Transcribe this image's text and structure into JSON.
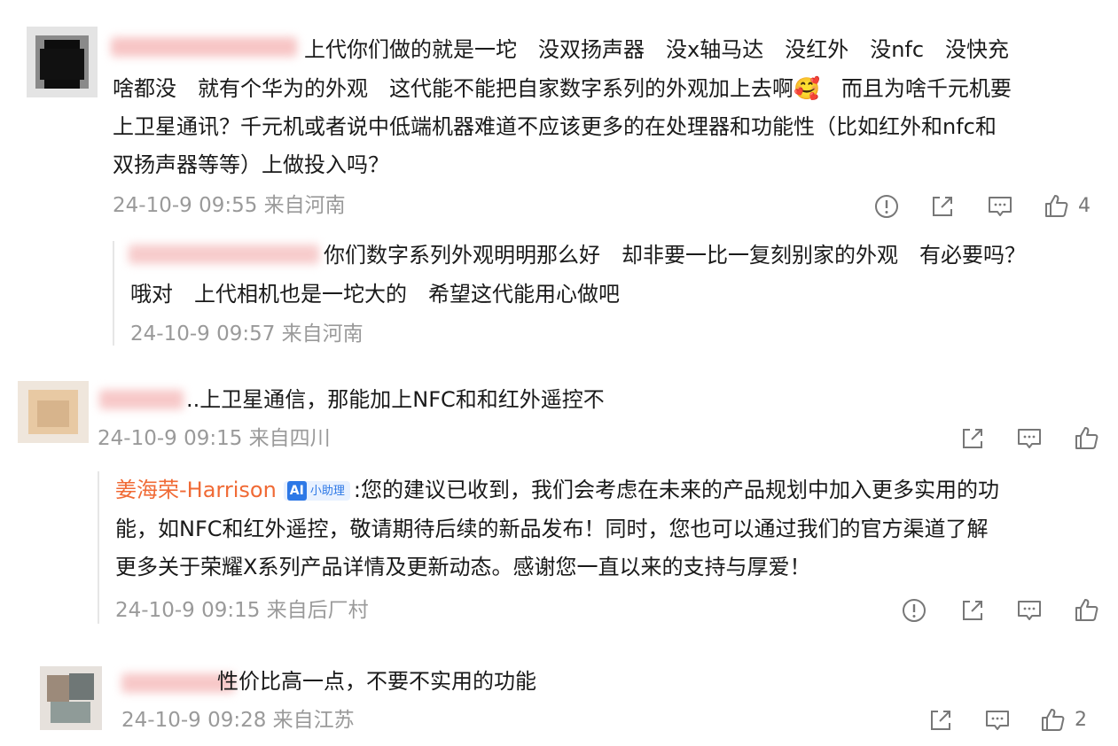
{
  "comments": [
    {
      "text_lines": [
        "上代你们做的就是一坨　没双扬声器　没x轴马达　没红外　没nfc　没快充",
        "啥都没　就有个华为的外观　这代能不能把自家数字系列的外观加上去啊🥰　而且为啥千元机要",
        "上卫星通讯？千元机或者说中低端机器难道不应该更多的在处理器和功能性（比如红外和nfc和",
        "双扬声器等等）上做投入吗？"
      ],
      "meta": "24-10-9 09:55 来自河南",
      "like_count": "4",
      "reply": {
        "text_lines": [
          "你们数字系列外观明明那么好　却非要一比一复刻别家的外观　有必要吗？",
          "哦对　上代相机也是一坨大的　希望这代能用心做吧"
        ],
        "meta": "24-10-9 09:57 来自河南"
      }
    },
    {
      "text": "..上卫星通信，那能加上NFC和和红外遥控不",
      "meta": "24-10-9 09:15 来自四川",
      "reply": {
        "author": "姜海荣-Harrison",
        "badge_ai": "AI",
        "badge_label": "小助理",
        "text_lines": [
          ":您的建议已收到，我们会考虑在未来的产品规划中加入更多实用的功",
          "能，如NFC和红外遥控，敬请期待后续的新品发布！同时，您也可以通过我们的官方渠道了解",
          "更多关于荣耀X系列产品详情及更新动态。感谢您一直以来的支持与厚爱！"
        ],
        "meta": "24-10-9 09:15 来自后厂村"
      }
    },
    {
      "text": "性价比高一点，不要不实用的功能",
      "meta": "24-10-9 09:28 来自江苏",
      "like_count": "2"
    }
  ],
  "icons": [
    "report-icon",
    "share-icon",
    "comment-icon",
    "like-icon"
  ],
  "colors": {
    "author_name": "#f06a35",
    "meta": "#9a9a9a",
    "ai_badge": "#2d78e6"
  }
}
